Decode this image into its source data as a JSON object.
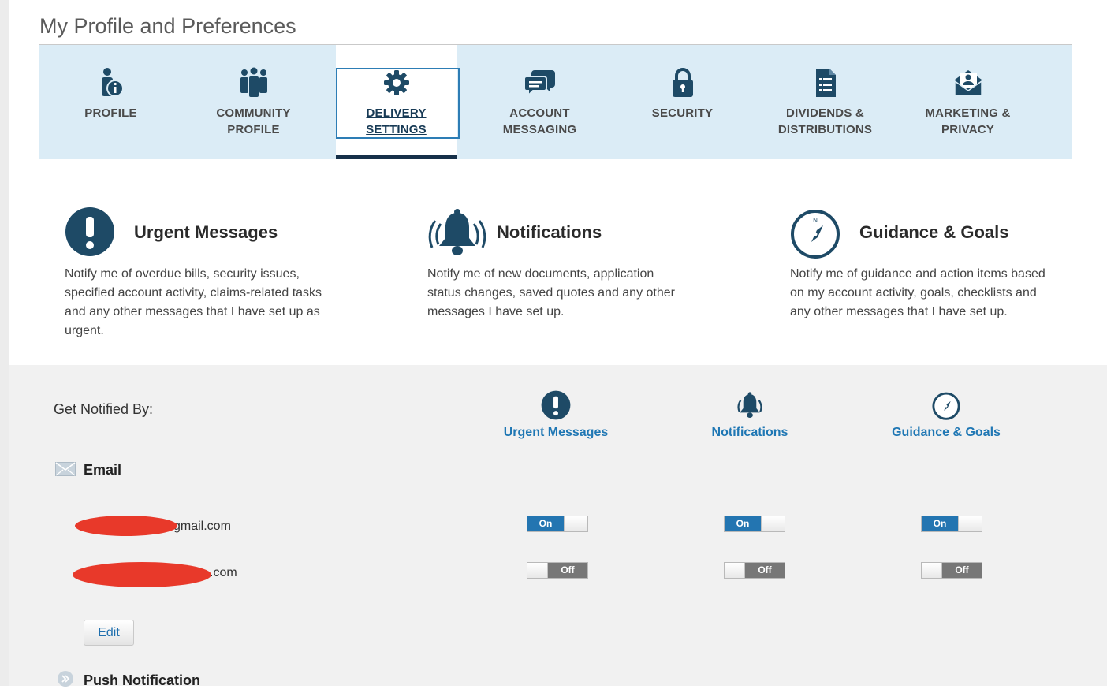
{
  "page": {
    "title": "My Profile and Preferences"
  },
  "tabs": [
    {
      "id": "profile",
      "line1": "PROFILE",
      "line2": "",
      "icon": "person-info-icon"
    },
    {
      "id": "community",
      "line1": "COMMUNITY",
      "line2": "PROFILE",
      "icon": "people-group-icon"
    },
    {
      "id": "delivery",
      "line1": "DELIVERY",
      "line2": "SETTINGS",
      "icon": "gear-icon",
      "active": true
    },
    {
      "id": "account-messaging",
      "line1": "ACCOUNT",
      "line2": "MESSAGING",
      "icon": "chat-bubbles-icon"
    },
    {
      "id": "security",
      "line1": "SECURITY",
      "line2": "",
      "icon": "lock-icon"
    },
    {
      "id": "dividends",
      "line1": "DIVIDENDS &",
      "line2": "DISTRIBUTIONS",
      "icon": "document-list-icon"
    },
    {
      "id": "marketing",
      "line1": "MARKETING &",
      "line2": "PRIVACY",
      "icon": "envelope-person-icon"
    }
  ],
  "categories": [
    {
      "id": "urgent",
      "title": "Urgent Messages",
      "icon": "exclamation-circle-icon",
      "description": "Notify me of overdue bills, security issues, specified account activity, claims-related tasks and any other messages that I have set up as urgent."
    },
    {
      "id": "notifications",
      "title": "Notifications",
      "icon": "bell-icon",
      "description": "Notify me of new documents, application status changes, saved quotes and any other messages I have set up."
    },
    {
      "id": "guidance",
      "title": "Guidance & Goals",
      "icon": "compass-icon",
      "description": "Notify me of guidance and action items based on my account activity, goals, checklists and any other messages that I have set up."
    }
  ],
  "notify": {
    "heading": "Get Notified By:",
    "columns": [
      "Urgent Messages",
      "Notifications",
      "Guidance & Goals"
    ],
    "email": {
      "label": "Email",
      "icon": "envelope-icon",
      "addresses": [
        {
          "visible_text": "gmail.com",
          "toggles": [
            "On",
            "On",
            "On"
          ]
        },
        {
          "visible_text": ".com",
          "toggles": [
            "Off",
            "Off",
            "Off"
          ]
        }
      ],
      "edit_label": "Edit"
    },
    "push": {
      "label": "Push Notification",
      "icon": "push-circle-icon"
    }
  },
  "colors": {
    "accent": "#1f77b4",
    "toggle_on": "#2375b1",
    "toggle_off": "#777777",
    "tab_bg": "#dbecf6",
    "icon_dark": "#1e4a66",
    "redaction": "#e8392a"
  }
}
